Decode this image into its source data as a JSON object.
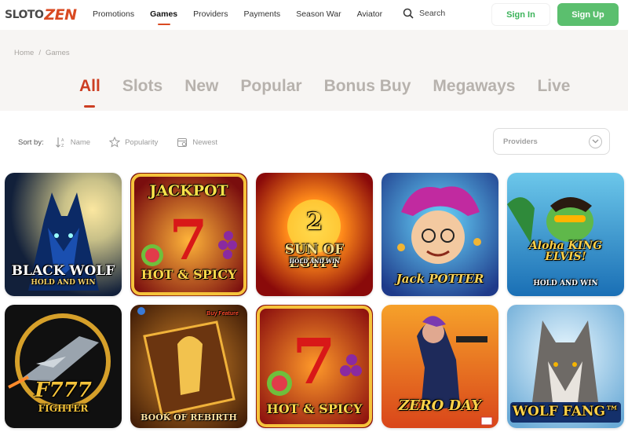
{
  "header": {
    "logo": {
      "part1": "SLOTO",
      "part2": "ZEN"
    },
    "nav": [
      "Promotions",
      "Games",
      "Providers",
      "Payments",
      "Season War",
      "Aviator"
    ],
    "active_nav": "Games",
    "search_label": "Search",
    "signin_label": "Sign In",
    "signup_label": "Sign Up"
  },
  "breadcrumb": {
    "home": "Home",
    "sep": "/",
    "current": "Games"
  },
  "tabs": [
    "All",
    "Slots",
    "New",
    "Popular",
    "Bonus Buy",
    "Megaways",
    "Live"
  ],
  "active_tab": "All",
  "sort": {
    "label": "Sort by:",
    "options": [
      "Name",
      "Popularity",
      "Newest"
    ]
  },
  "providers_select": {
    "label": "Providers"
  },
  "colors": {
    "accent": "#cc3e22",
    "signup_bg": "#5bbf6e",
    "signin_text": "#3cb35a",
    "band_bg": "#f7f5f3"
  },
  "games": [
    {
      "title": "BLACK WOLF",
      "subtitle": "HOLD AND WIN"
    },
    {
      "title": "JACKPOT",
      "subtitle": "HOT & SPICY"
    },
    {
      "title": "SUN OF EGYPT",
      "subtitle": "HOLD AND WIN",
      "badge": "2"
    },
    {
      "title": "Jack POTTER",
      "subtitle": ""
    },
    {
      "title": "Aloha KING ELVIS!",
      "subtitle": "HOLD AND WIN"
    },
    {
      "title": "F777",
      "subtitle": "FIGHTER"
    },
    {
      "title": "BOOK OF REBIRTH",
      "subtitle": "",
      "badge": "Buy Feature"
    },
    {
      "title": "HOT & SPICY",
      "subtitle": ""
    },
    {
      "title": "ZERO DAY",
      "subtitle": ""
    },
    {
      "title": "WOLF FANG™",
      "subtitle": ""
    }
  ]
}
